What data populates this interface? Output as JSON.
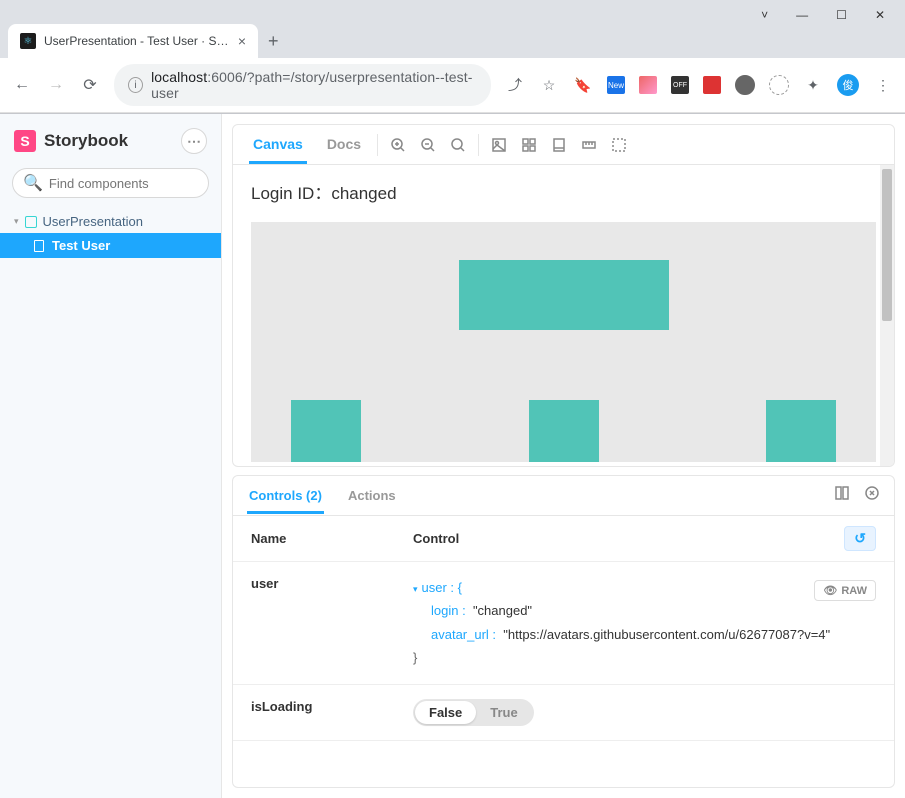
{
  "browser": {
    "tab_title": "UserPresentation - Test User · Sto…",
    "url_host": "localhost",
    "url_port": ":6006",
    "url_path": "/?path=/story/userpresentation--test-user",
    "avatar_char": "俊"
  },
  "storybook": {
    "brand": "Storybook",
    "search_placeholder": "Find components",
    "search_shortcut": "/",
    "tree": {
      "component": "UserPresentation",
      "story": "Test User"
    }
  },
  "toolbar": {
    "canvas": "Canvas",
    "docs": "Docs"
  },
  "preview": {
    "login_line": "Login ID：changed"
  },
  "addons": {
    "controls_tab": "Controls (2)",
    "actions_tab": "Actions",
    "col_name": "Name",
    "col_control": "Control",
    "reset_icon": "↺",
    "raw_label": "RAW",
    "controls": {
      "user": {
        "name": "user",
        "root": "user : {",
        "login_key": "login :",
        "login_val": "\"changed\"",
        "avatar_key": "avatar_url :",
        "avatar_val": "\"https://avatars.githubusercontent.com/u/62677087?v=4\"",
        "close": "}"
      },
      "isLoading": {
        "name": "isLoading",
        "false": "False",
        "true": "True"
      }
    }
  }
}
